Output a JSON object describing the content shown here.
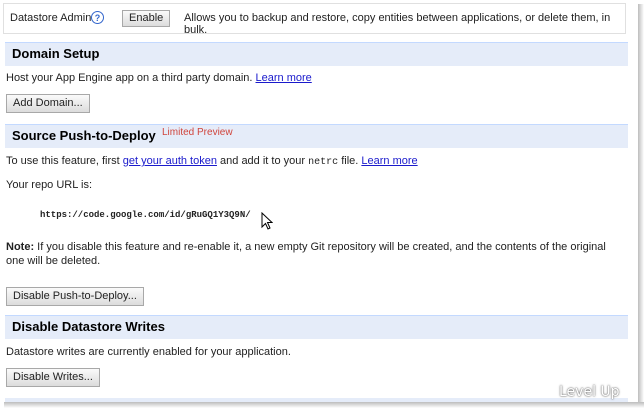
{
  "datastore_admin": {
    "label": "Datastore Admin",
    "help_icon": "help-icon",
    "enable_label": "Enable",
    "description": "Allows you to backup and restore, copy entities between applications, or delete them, in bulk."
  },
  "domain_setup": {
    "title": "Domain Setup",
    "text": "Host your App Engine app on a third party domain.",
    "learn_more": "Learn more",
    "button": "Add Domain..."
  },
  "push_to_deploy": {
    "title": "Source Push-to-Deploy",
    "badge": "Limited Preview",
    "intro_prefix": "To use this feature, first",
    "auth_link": "get your auth token",
    "intro_middle": "and add it to your",
    "netrc": "netrc",
    "intro_suffix": "file.",
    "learn_more": "Learn more",
    "repo_label": "Your repo URL is:",
    "repo_url": "https://code.google.com/id/gRuGQ1Y3Q9N/",
    "note_label": "Note:",
    "note_text": "If you disable this feature and re-enable it, a new empty Git repository will be created, and the contents of the original one will be deleted.",
    "button": "Disable Push-to-Deploy..."
  },
  "datastore_writes": {
    "title": "Disable Datastore Writes",
    "text": "Datastore writes are currently enabled for your application.",
    "button": "Disable Writes..."
  },
  "watermark": "Level Up"
}
